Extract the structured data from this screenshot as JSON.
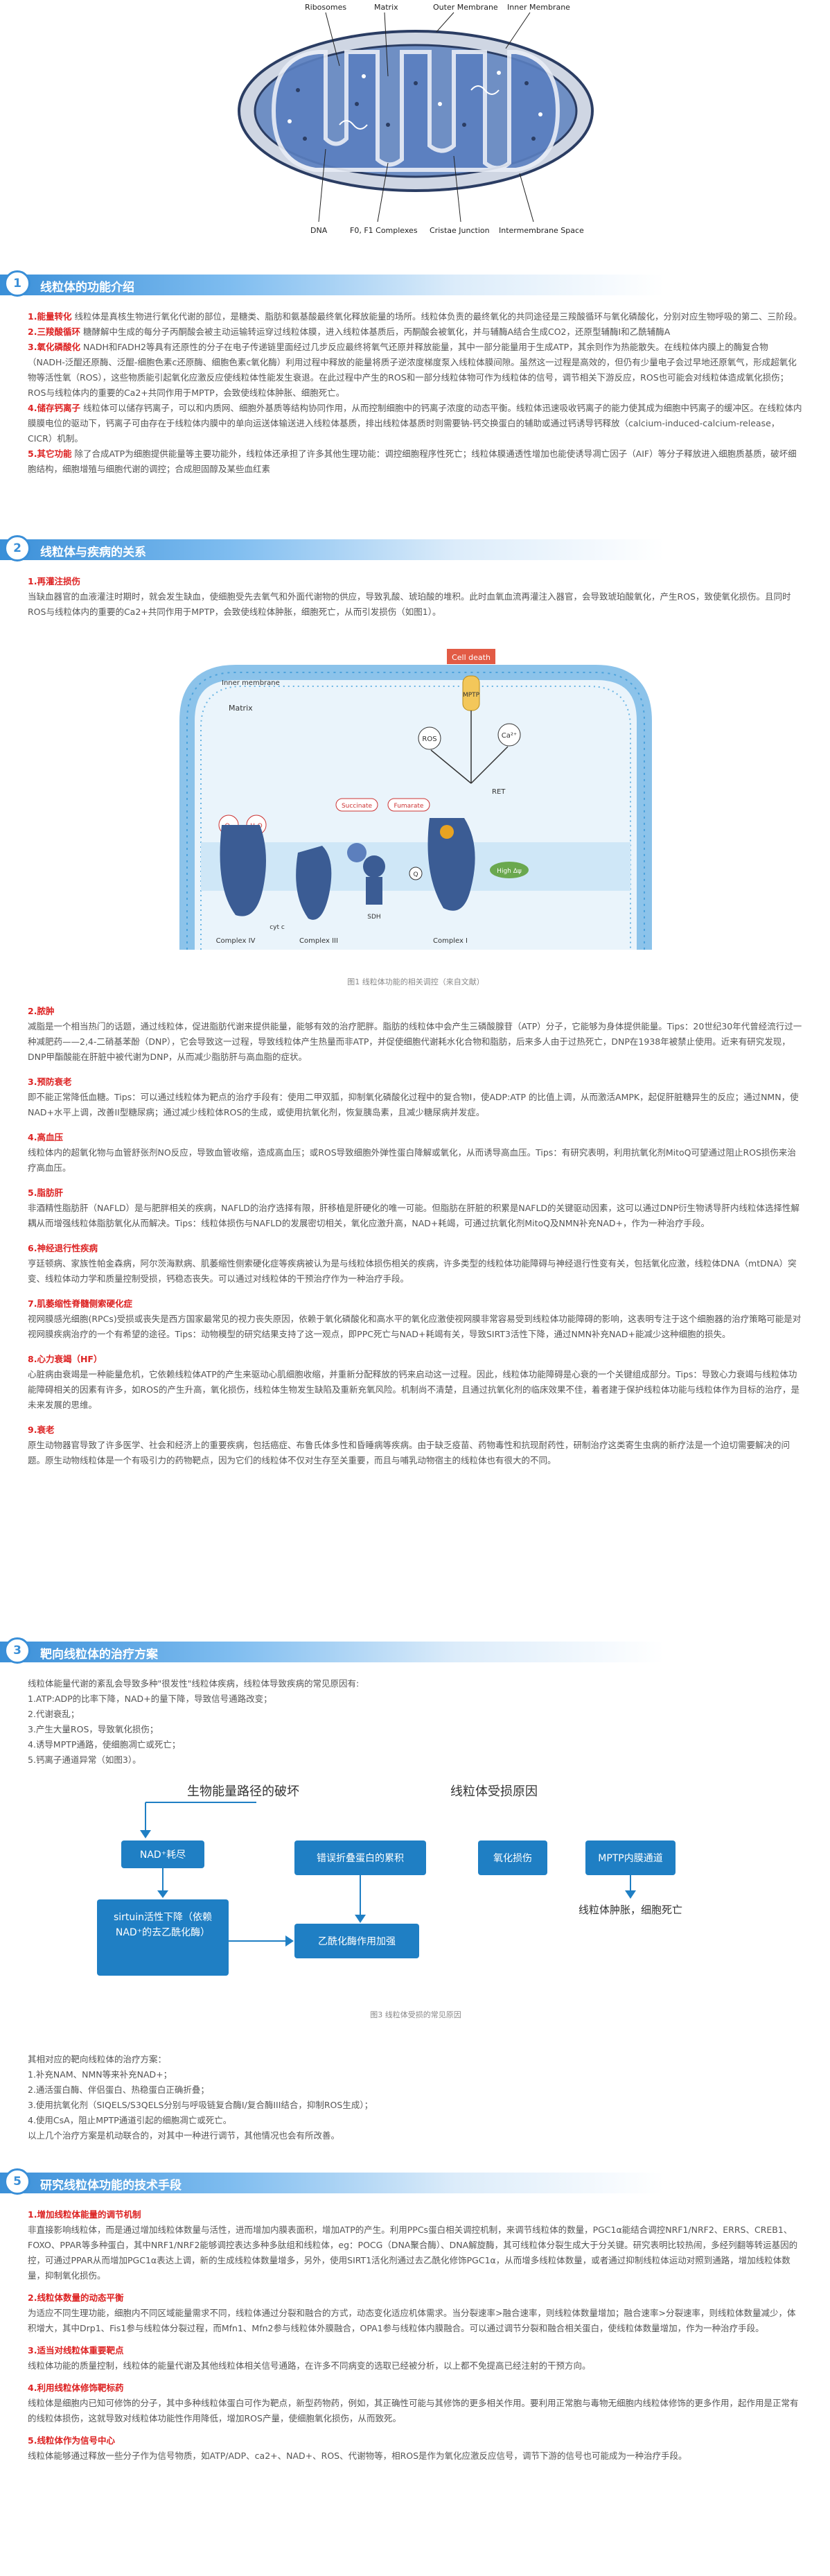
{
  "fig1": {
    "labels": [
      "Ribosomes",
      "Matrix",
      "Outer Membrane",
      "Inner Membrane",
      "DNA",
      "F0, F1 Complexes",
      "Cristae Junction",
      "Intermembrane Space"
    ]
  },
  "sections": [
    {
      "num": "1",
      "title": "线粒体的功能介绍"
    },
    {
      "num": "2",
      "title": "线粒体与疾病的关系"
    },
    {
      "num": "3",
      "title": "靶向线粒体的治疗方案"
    },
    {
      "num": "5",
      "title": "研究线粒体功能的技术手段"
    }
  ],
  "s1": {
    "intro": "线粒体是真核生物进行氧化代谢的部位，是糖类、脂肪和氨基酸最终氧化释放能量的场所。线粒体负责的最终氧化的共同途径是三羧酸循环与氧化磷酸化，分别对应生物呼吸的第二、三阶段。",
    "items": [
      {
        "label": "1.能量转化",
        "text": "线粒体是真核生物进行氧化代谢的部位，是糖类、脂肪和氨基酸最终氧化释放能量的场所。线粒体负责的最终氧化的共同途径是三羧酸循环与氧化磷酸化，分别对应生物呼吸的第二、三阶段。"
      },
      {
        "label": "2.三羧酸循环",
        "text": "糖酵解中生成的每分子丙酮酸会被主动运输转运穿过线粒体膜，进入线粒体基质后，丙酮酸会被氧化，并与辅酶A结合生成CO2，还原型辅酶Ⅰ和乙酰辅酶A"
      },
      {
        "label": "3.氧化磷酸化",
        "text": "NADH和FADH2等具有还原性的分子在电子传递链里面经过几步反应最终将氧气还原并释放能量，其中一部分能量用于生成ATP，其余则作为热能散失。在线粒体内膜上的酶复合物（NADH-泛醌还原酶、泛醌-细胞色素c还原酶、细胞色素c氧化酶）利用过程中释放的能量将质子逆浓度梯度泵入线粒体膜间隙。虽然这一过程是高效的，但仍有少量电子会过早地还原氧气，形成超氧化物等活性氧（ROS），这些物质能引起氧化应激反应使线粒体性能发生衰退。在此过程中产生的ROS和一部分线粒体物可作为线粒体的信号，调节相关下游反应，ROS也可能会对线粒体造成氧化损伤；ROS与线粒体内的重要的Ca2+共同作用于MPTP，会致使线粒体肿胀、细胞死亡。"
      },
      {
        "label": "4.储存钙离子",
        "text": "线粒体可以储存钙离子，可以和内质网、细胞外基质等结构协同作用，从而控制细胞中的钙离子浓度的动态平衡。线粒体迅速吸收钙离子的能力使其成为细胞中钙离子的缓冲区。在线粒体内膜膜电位的驱动下，钙离子可由存在于线粒体内膜中的单向运送体输送进入线粒体基质，排出线粒体基质时则需要钠-钙交换蛋白的辅助或通过钙诱导钙释放（calcium-induced-calcium-release，CICR）机制。"
      },
      {
        "label": "5.其它功能",
        "text": "除了合成ATP为细胞提供能量等主要功能外，线粒体还承担了许多其他生理功能：调控细胞程序性死亡；线粒体膜通透性增加也能使诱导凋亡因子（AIF）等分子释放进入细胞质基质，破坏细胞结构，细胞增殖与细胞代谢的调控；合成胆固醇及某些血红素"
      }
    ]
  },
  "s2": {
    "ischemia": {
      "label": "1.再灌注损伤",
      "text": "当缺血器官的血液灌注时期时，就会发生缺血，使细胞受先去氧气和外面代谢物的供应，导致乳酸、琥珀酸的堆积。此时血氧血流再灌注入器官，会导致琥珀酸氧化，产生ROS，致使氧化损伤。且同时ROS与线粒体内的重要的Ca2+共同作用于MPTP，会致使线粒体肿胀，细胞死亡，从而引发损伤（如图1）。"
    },
    "fig2": {
      "cell_death": "Cell death",
      "inner_membrane": "Inner membrane",
      "matrix": "Matrix",
      "mptp": "MPTP",
      "ros": "ROS",
      "ca": "Ca²⁺",
      "ret": "RET",
      "succinate": "Succinate",
      "fumarate": "Fumarate",
      "sdh": "SDH",
      "high_dpsi": "High Δψ",
      "o2": "O₂",
      "h2o": "H₂O",
      "q": "Q",
      "complex4": "Complex IV",
      "complex3": "Complex III",
      "complex1": "Complex I",
      "cyt": "cyt c",
      "caption": "图1 线粒体功能的相关调控（来自文献）"
    },
    "items": [
      {
        "label": "2.脓肿",
        "text": "减脂是一个相当热门的话题，通过线粒体，促进脂肪代谢来提供能量，能够有效的治疗肥胖。脂肪的线粒体中会产生三磷酸腺苷（ATP）分子，它能够为身体提供能量。Tips：20世纪30年代曾经流行过一种减肥药——2,4-二硝基苯酚（DNP），它会导致这一过程，导致线粒体产生热量而非ATP，并促使细胞代谢耗水化合物和脂肪，后来多人由于过热死亡，DNP在1938年被禁止使用。近来有研究发现，DNP甲酯酸能在肝脏中被代谢为DNP，从而减少脂肪肝与高血脂的症状。"
      },
      {
        "label": "3.预防衰老",
        "text": "即不能正常降低血糖。Tips：可以通过线粒体为靶点的治疗手段有：使用二甲双胍，抑制氧化磷酸化过程中的复合物I，使ADP:ATP 的比值上调，从而激活AMPK，起促肝脏糖异生的反应；通过NMN，使NAD+水平上调，改善II型糖尿病；通过减少线粒体ROS的生成，或使用抗氧化剂，恢复胰岛素，且减少糖尿病并发症。"
      },
      {
        "label": "4.高血压",
        "text": "线粒体内的超氧化物与血管舒张剂NO反应，导致血管收缩，造成高血压；或ROS导致细胞外弹性蛋白降解或氧化，从而诱导高血压。Tips：有研究表明，利用抗氧化剂MitoQ可望通过阻止ROS损伤来治疗高血压。"
      },
      {
        "label": "5.脂肪肝",
        "text": "非酒精性脂肪肝（NAFLD）是与肥胖相关的疾病，NAFLD的治疗选择有限，肝移植是肝硬化的唯一可能。但脂肪在肝脏的积累是NAFLD的关键驱动因素，这可以通过DNP衍生物诱导肝内线粒体选择性解耦从而增强线粒体脂肪氧化从而解决。Tips：线粒体损伤与NAFLD的发展密切相关，氧化应激升高，NAD+耗竭，可通过抗氧化剂MitoQ及NMN补充NAD+，作为一种治疗手段。"
      },
      {
        "label": "6.神经退行性疾病",
        "text": "亨廷顿病、家族性帕金森病，阿尔茨海默病、肌萎缩性侧索硬化症等疾病被认为是与线粒体损伤相关的疾病，许多类型的线粒体功能障碍与神经退行性变有关，包括氧化应激，线粒体DNA（mtDNA）突变、线粒体动力学和质量控制受损，钙稳态丧失。可以通过对线粒体的干预治疗作为一种治疗手段。"
      },
      {
        "label": "7.肌萎缩性脊髓侧索硬化症",
        "text": "视网膜感光细胞(RPCs)受损或丧失是西方国家最常见的视力丧失原因，依赖于氧化磷酸化和高水平的氧化应激使视网膜非常容易受到线粒体功能障碍的影响，这表明专注于这个细胞器的治疗策略可能是对视网膜疾病治疗的一个有希望的途径。Tips：动物模型的研究结果支持了这一观点，即PPC死亡与NAD+耗竭有关，导致SIRT3活性下降，通过NMN补充NAD+能减少这种细胞的损失。"
      },
      {
        "label": "8.心力衰竭（HF）",
        "text": "心脏病由衰竭是一种能量危机，它依赖线粒体ATP的产生来驱动心肌细胞收缩，并重新分配释放的钙来启动这一过程。因此，线粒体功能障碍是心衰的一个关键组成部分。Tips：导致心力衰竭与线粒体功能障碍相关的因素有许多，如ROS的产生升高，氧化损伤，线粒体生物发生缺陷及重新充氧风险。机制尚不清楚，且通过抗氧化剂的临床效果不佳，着者建于保护线粒体功能与线粒体作为目标的治疗，是未来发展的思维。"
      },
      {
        "label": "9.衰老",
        "text": "原生动物器官导致了许多医学、社会和经济上的重要疾病，包括癌症、布鲁氏体多性和昏睡病等疾病。由于缺乏疫苗、药物毒性和抗现耐药性，研制治疗这类寄生虫病的新疗法是一个迫切需要解决的问题。原生动物线粒体是一个有吸引力的药物靶点，因为它们的线粒体不仅对生存至关重要，而且与哺乳动物宿主的线粒体也有很大的不同。"
      }
    ]
  },
  "s3": {
    "intro": "线粒体能量代谢的紊乱会导致多种\"很发性\"线粒体疾病，线粒体导致疾病的常见原因有:",
    "list": [
      "1.ATP:ADP的比率下降，NAD+的量下降，导致信号通路改变；",
      "2.代谢衰乱；",
      "3.产生大量ROS，导致氧化损伤；",
      "4.诱导MPTP通路，使细胞凋亡或死亡；",
      "5.钙离子通道异常（如图3）。"
    ],
    "fig3": {
      "left_title": "生物能量路径的破坏",
      "right_title": "线粒体受损原因",
      "nad": "NAD⁺耗尽",
      "sirtuin": "sirtuin活性下降（依赖NAD⁺的去乙酰化酶）",
      "acetyl": "乙酰化酶作用加强",
      "misfold": "错误折叠蛋白的累积",
      "oxid": "氧化损伤",
      "mptp": "MPTP内膜通道",
      "swell": "线粒体肿胀，细胞死亡",
      "caption": "图3 线粒体受损的常见原因"
    },
    "treat_title": "其相对应的靶向线粒体的治疗方案：",
    "treat": [
      "1.补充NAM、NMN等来补充NAD+；",
      "2.通活蛋白酶、伴侣蛋白、热稳蛋白正确折叠；",
      "3.使用抗氧化剂（SIQELS/S3QELS分别与呼吸链复合酶I/复合酶III结合，抑制ROS生成）；",
      "4.使用CsA，阻止MPTP通道引起的细胞凋亡或死亡。",
      "以上几个治疗方案是机动联合的，对其中一种进行调节，其他情况也会有所改善。"
    ]
  },
  "s5": {
    "items": [
      {
        "label": "1.增加线粒体能量的调节机制",
        "text": "非直接影响线粒体，而是通过增加线粒体数量与活性，进而增加内膜表面积，增加ATP的产生。利用PPCs蛋白相关调控机制，来调节线粒体的数量，PGC1α能结合调控NRF1/NRF2、ERRS、CREB1、FOXO、PPAR等多种蛋白，其中NRF1/NRF2能够调控表达多种多肽组和线粒体，eg：POCG（DNA聚合酶）、DNA解旋酶，其可线粒体分裂生成大于分关键。研究表明比较热闹，多经列翻等转运基因的控，可通过PPAR从而增加PGC1α表达上调，新的生成线粒体数量增多，另外，使用SIRT1活化剂通过去乙酰化修饰PGC1α，从而增多线粒体数量，或者通过抑制线粒体运动对照到通路，增加线粒体数量，抑制氧化损伤。"
      },
      {
        "label": "2.线粒体数量的动态平衡",
        "text": "为适应不同生理功能，细胞内不同区域能量需求不同，线粒体通过分裂和融合的方式，动态变化适应机体需求。当分裂速率>融合速率，则线粒体数量增加；融合速率>分裂速率，则线粒体数量减少，体积增大，其中Drp1、Fis1参与线粒体分裂过程，而Mfn1、Mfn2参与线粒体外膜融合，OPA1参与线粒体内膜融合。可以通过调节分裂和融合相关蛋白，使线粒体数量增加，作为一种治疗手段。"
      },
      {
        "label": "3.适当对线粒体重要靶点",
        "text": "线粒体功能的质量控制，线粒体的能量代谢及其他线粒体相关信号通路，在许多不同病变的选取已经被分析，以上都不免提高已经注射的干预方向。"
      },
      {
        "label": "4.利用线粒体修饰靶标药",
        "text": "线粒体是细胞内已知可修饰的分子，其中多种线粒体蛋白可作为靶点，新型药物药，例如，其正确性可能与其修饰的更多相关作用。要利用正常胞与毒物无细胞内线粒体修饰的更多作用，起作用是正常有的线粒体损伤，这就导致对线粒体功能性作用降低，增加ROS产量，使细胞氧化损伤，从而致死。"
      },
      {
        "label": "5.线粒体作为信号中心",
        "text": "线粒体能够通过释放一些分子作为信号物质，如ATP/ADP、ca2+、NAD+、ROS、代谢物等，相ROS是作为氧化应激反应信号，调节下游的信号也可能成为一种治疗手段。"
      }
    ]
  }
}
